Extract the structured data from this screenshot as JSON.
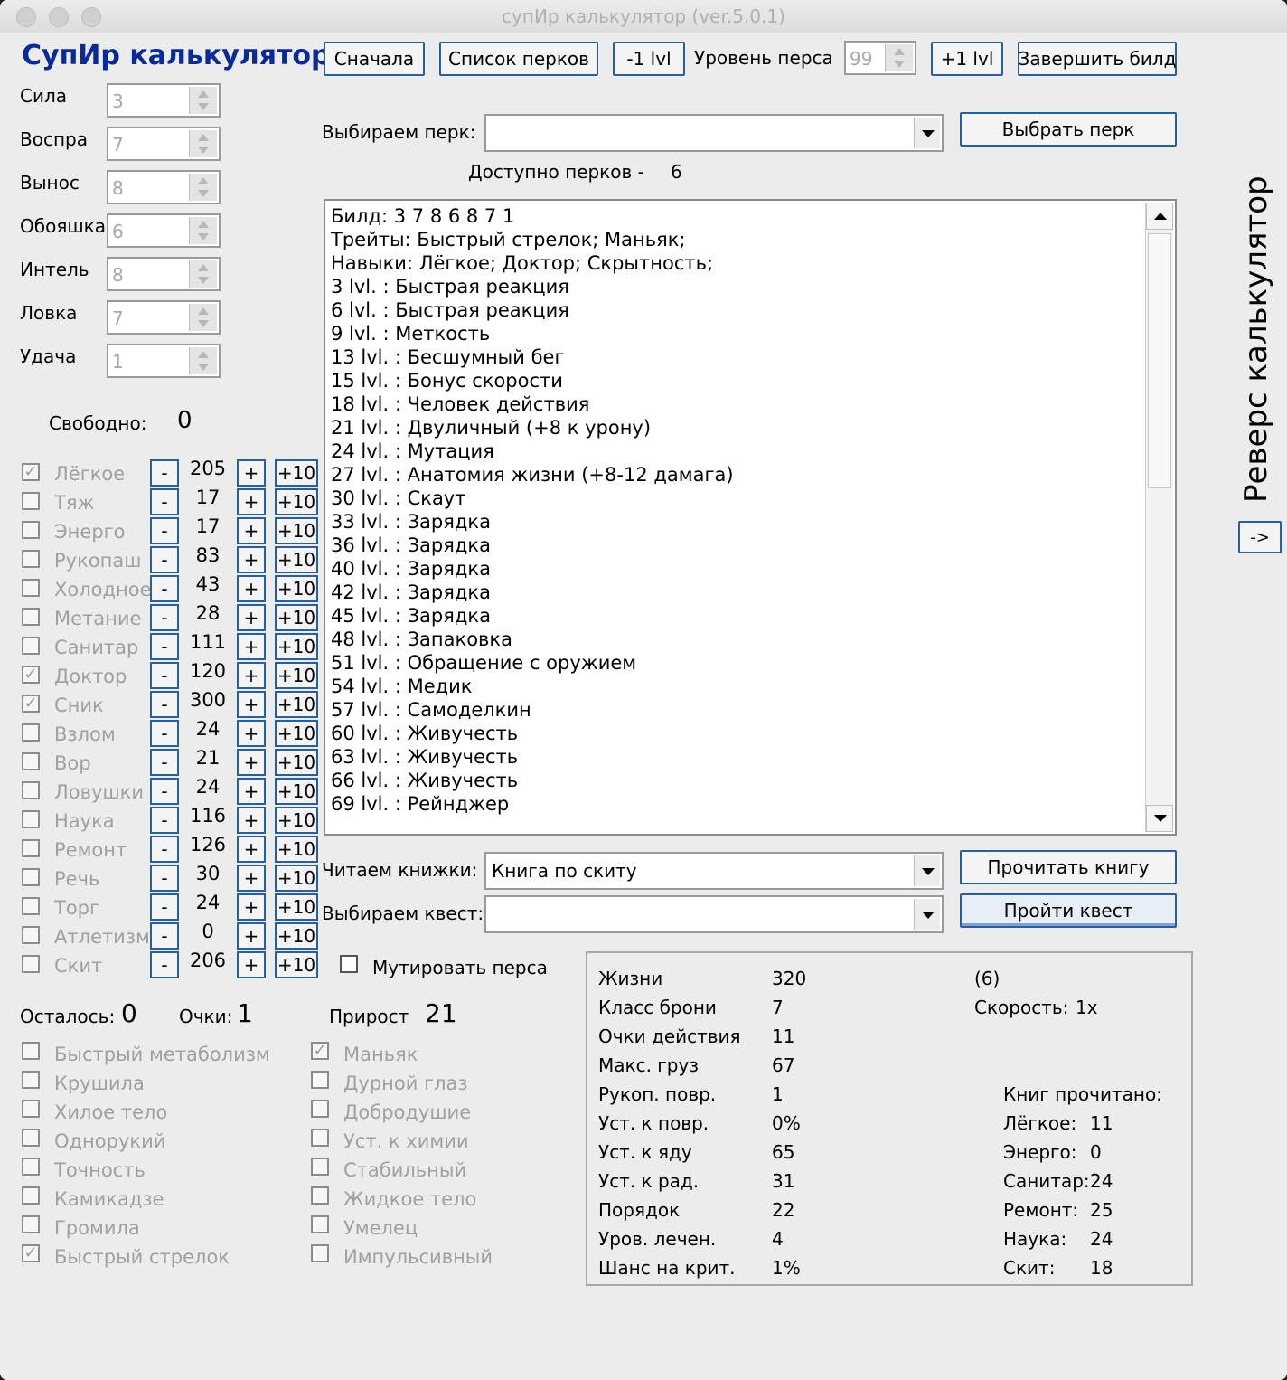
{
  "window": {
    "title": "супИр калькулятор (ver.5.0.1)"
  },
  "app_title": "СупИр калькулятор",
  "toolbar": {
    "reset": "Сначала",
    "perk_list": "Список перков",
    "minus_lvl": "-1 lvl",
    "level_label": "Уровень перса",
    "level_value": "99",
    "plus_lvl": "+1 lvl",
    "finish": "Завершить билд"
  },
  "stats": [
    {
      "label": "Сила",
      "value": "3"
    },
    {
      "label": "Воспра",
      "value": "7"
    },
    {
      "label": "Вынос",
      "value": "8"
    },
    {
      "label": "Обояшка",
      "value": "6"
    },
    {
      "label": "Интель",
      "value": "8"
    },
    {
      "label": "Ловка",
      "value": "7"
    },
    {
      "label": "Удача",
      "value": "1"
    }
  ],
  "free": {
    "label": "Свободно:",
    "value": "0"
  },
  "perk_pick": {
    "label": "Выбираем перк:",
    "value": "",
    "button": "Выбрать перк",
    "available_label": "Доступно перков -",
    "available_value": "6"
  },
  "build_log": [
    "Билд: 3 7 8 6 8 7 1",
    "Трейты: Быстрый стрелок; Маньяк;",
    "Навыки: Лёгкое; Доктор; Скрытность;",
    "3 lvl. : Быстрая реакция",
    "6 lvl. : Быстрая реакция",
    "9 lvl. : Меткость",
    "13 lvl. : Бесшумный бег",
    "15 lvl. : Бонус скорости",
    "18 lvl. : Человек действия",
    "21 lvl. : Двуличный (+8 к урону)",
    "24 lvl. : Мутация",
    "27 lvl. : Анатомия жизни (+8-12 дамага)",
    "30 lvl. : Скаут",
    "33 lvl. : Зарядка",
    "36 lvl. : Зарядка",
    "40 lvl. : Зарядка",
    "42 lvl. : Зарядка",
    "45 lvl. : Зарядка",
    "48 lvl. : Запаковка",
    "51 lvl. : Обращение с оружием",
    "54 lvl. : Медик",
    "57 lvl. : Самоделкин",
    "60 lvl. : Живучесть",
    "63 lvl. : Живучесть",
    "66 lvl. : Живучесть",
    "69 lvl. : Рейнджер"
  ],
  "skills": [
    {
      "name": "Лёгкое",
      "value": "205",
      "checked": true
    },
    {
      "name": "Тяж",
      "value": "17",
      "checked": false
    },
    {
      "name": "Энерго",
      "value": "17",
      "checked": false
    },
    {
      "name": "Рукопаш",
      "value": "83",
      "checked": false
    },
    {
      "name": "Холодное",
      "value": "43",
      "checked": false
    },
    {
      "name": "Метание",
      "value": "28",
      "checked": false
    },
    {
      "name": "Санитар",
      "value": "111",
      "checked": false
    },
    {
      "name": "Доктор",
      "value": "120",
      "checked": true
    },
    {
      "name": "Сник",
      "value": "300",
      "checked": true
    },
    {
      "name": "Взлом",
      "value": "24",
      "checked": false
    },
    {
      "name": "Вор",
      "value": "21",
      "checked": false
    },
    {
      "name": "Ловушки",
      "value": "24",
      "checked": false
    },
    {
      "name": "Наука",
      "value": "116",
      "checked": false
    },
    {
      "name": "Ремонт",
      "value": "126",
      "checked": false
    },
    {
      "name": "Речь",
      "value": "30",
      "checked": false
    },
    {
      "name": "Торг",
      "value": "24",
      "checked": false
    },
    {
      "name": "Атлетизм",
      "value": "0",
      "checked": false
    },
    {
      "name": "Скит",
      "value": "206",
      "checked": false
    }
  ],
  "skill_buttons": {
    "minus": "-",
    "plus": "+",
    "plus10": "+10"
  },
  "mutate": {
    "label": "Мутировать перса",
    "checked": false
  },
  "books": {
    "label": "Читаем книжки:",
    "value": "Книга по скиту",
    "button": "Прочитать книгу"
  },
  "quests": {
    "label": "Выбираем квест:",
    "value": "",
    "button": "Пройти квест"
  },
  "points": {
    "left_label": "Осталось:",
    "left_value": "0",
    "score_label": "Очки:",
    "score_value": "1",
    "gain_label": "Прирост",
    "gain_value": "21"
  },
  "traits_left": [
    {
      "name": "Быстрый метаболизм",
      "checked": false
    },
    {
      "name": "Крушила",
      "checked": false
    },
    {
      "name": "Хилое тело",
      "checked": false
    },
    {
      "name": "Однорукий",
      "checked": false
    },
    {
      "name": "Точность",
      "checked": false
    },
    {
      "name": "Камикадзе",
      "checked": false
    },
    {
      "name": "Громила",
      "checked": false
    },
    {
      "name": "Быстрый стрелок",
      "checked": true
    }
  ],
  "traits_right": [
    {
      "name": "Маньяк",
      "checked": true
    },
    {
      "name": "Дурной глаз",
      "checked": false
    },
    {
      "name": "Добродушие",
      "checked": false
    },
    {
      "name": "Уст. к химии",
      "checked": false
    },
    {
      "name": "Стабильный",
      "checked": false
    },
    {
      "name": "Жидкое тело",
      "checked": false
    },
    {
      "name": "Умелец",
      "checked": false
    },
    {
      "name": "Импульсивный",
      "checked": false
    }
  ],
  "derived": [
    {
      "label": "Жизни",
      "value": "320"
    },
    {
      "label": "Класс брони",
      "value": "7"
    },
    {
      "label": "Очки действия",
      "value": "11"
    },
    {
      "label": "Макс. груз",
      "value": "67"
    },
    {
      "label": "Рукоп. повр.",
      "value": "1"
    },
    {
      "label": "Уст. к повр.",
      "value": "0%"
    },
    {
      "label": "Уст. к яду",
      "value": "65"
    },
    {
      "label": "Уст. к рад.",
      "value": "31"
    },
    {
      "label": "Порядок",
      "value": "22"
    },
    {
      "label": "Уров. лечен.",
      "value": "4"
    },
    {
      "label": "Шанс на крит.",
      "value": "1%"
    }
  ],
  "extra": {
    "paren": "(6)",
    "speed_label": "Скорость:",
    "speed_value": "1x"
  },
  "books_read": {
    "title": "Книг прочитано:",
    "items": [
      {
        "label": "Лёгкое:",
        "value": "11"
      },
      {
        "label": "Энерго:",
        "value": "0"
      },
      {
        "label": "Санитар:",
        "value": "24"
      },
      {
        "label": "Ремонт:",
        "value": "25"
      },
      {
        "label": "Наука:",
        "value": "24"
      },
      {
        "label": "Скит:",
        "value": "18"
      }
    ]
  },
  "reverse": {
    "label": "Реверс калькулятор",
    "button": "->"
  }
}
